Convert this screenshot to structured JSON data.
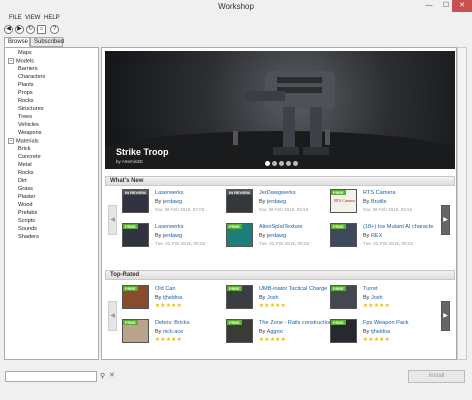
{
  "window": {
    "title": "Workshop"
  },
  "menu": [
    "FILE",
    "VIEW",
    "HELP"
  ],
  "tabs": [
    "Browse",
    "Subscribed"
  ],
  "tree": [
    {
      "label": "Maps",
      "level": 1,
      "expander": ""
    },
    {
      "label": "Models",
      "level": 0,
      "expander": "−"
    },
    {
      "label": "Barriers",
      "level": 1,
      "expander": ""
    },
    {
      "label": "Characters",
      "level": 1,
      "expander": ""
    },
    {
      "label": "Plants",
      "level": 1,
      "expander": ""
    },
    {
      "label": "Props",
      "level": 1,
      "expander": ""
    },
    {
      "label": "Rocks",
      "level": 1,
      "expander": ""
    },
    {
      "label": "Structures",
      "level": 1,
      "expander": ""
    },
    {
      "label": "Trees",
      "level": 1,
      "expander": ""
    },
    {
      "label": "Vehicles",
      "level": 1,
      "expander": ""
    },
    {
      "label": "Weapons",
      "level": 1,
      "expander": ""
    },
    {
      "label": "Materials",
      "level": 0,
      "expander": "−"
    },
    {
      "label": "Brick",
      "level": 1,
      "expander": ""
    },
    {
      "label": "Concrete",
      "level": 1,
      "expander": ""
    },
    {
      "label": "Metal",
      "level": 1,
      "expander": ""
    },
    {
      "label": "Rocks",
      "level": 1,
      "expander": ""
    },
    {
      "label": "Dirt",
      "level": 1,
      "expander": ""
    },
    {
      "label": "Grass",
      "level": 1,
      "expander": ""
    },
    {
      "label": "Plaster",
      "level": 1,
      "expander": ""
    },
    {
      "label": "Wood",
      "level": 1,
      "expander": ""
    },
    {
      "label": "Prefabs",
      "level": 0,
      "expander": ""
    },
    {
      "label": "Scripts",
      "level": 0,
      "expander": ""
    },
    {
      "label": "Sounds",
      "level": 0,
      "expander": ""
    },
    {
      "label": "Shaders",
      "level": 0,
      "expander": ""
    }
  ],
  "featured": {
    "title": "Strike Troop",
    "author": "by Artemis3D",
    "slide_count": 5,
    "active_slide": 0
  },
  "sections": [
    {
      "title": "What's New",
      "items": [
        {
          "name": "Laserwerks",
          "by_label": "By",
          "author": "jerdawg",
          "date": "Sat, 06 Feb 2016, 07:03",
          "badge": "IN REVIEW",
          "badge_color": "#555555",
          "thumb_bg": "#2f3440"
        },
        {
          "name": "JerDawgwerks",
          "by_label": "By",
          "author": "jerdawg",
          "date": "Sat, 06 Feb 2016, 06:53",
          "badge": "IN REVIEW",
          "badge_color": "#555555",
          "thumb_bg": "#34383e"
        },
        {
          "name": "RTS Camera",
          "by_label": "By",
          "author": "Brutile",
          "date": "Sat, 06 Feb 2016, 06:52",
          "badge": "FREE",
          "badge_color": "#5cae2e",
          "thumb_bg": "#f4f1ea",
          "thumb_text": "RTS Camera"
        },
        {
          "name": "Laserwerks",
          "by_label": "By",
          "author": "jerdawg",
          "date": "Tue, 02 Feb 2016, 06:03",
          "badge": "FREE",
          "badge_color": "#5cae2e",
          "thumb_bg": "#2f3440"
        },
        {
          "name": "AlienSplatTexture",
          "by_label": "By",
          "author": "jerdawg",
          "date": "Tue, 02 Feb 2016, 06:03",
          "badge": "FREE",
          "badge_color": "#5cae2e",
          "thumb_bg": "#1e7f7a"
        },
        {
          "name": "(18+) Ice Mutant AI characte",
          "by_label": "By",
          "author": "REX",
          "date": "Tue, 02 Feb 2016, 06:02",
          "badge": "FREE",
          "badge_color": "#5cae2e",
          "thumb_bg": "#3d4a5c"
        }
      ]
    },
    {
      "title": "Top-Rated",
      "items": [
        {
          "name": "Old Can",
          "by_label": "By",
          "author": "tjheldna",
          "rating": "★★★★★",
          "badge": "FREE",
          "badge_color": "#5cae2e",
          "thumb_bg": "#8a4a2c"
        },
        {
          "name": "UMB-inator Tactical Charge",
          "by_label": "By",
          "author": "Josh",
          "rating": "★★★★★",
          "badge": "FREE",
          "badge_color": "#5cae2e",
          "thumb_bg": "#3a3e44"
        },
        {
          "name": "Turret",
          "by_label": "By",
          "author": "Josh",
          "rating": "★★★★★",
          "badge": "FREE",
          "badge_color": "#5cae2e",
          "thumb_bg": "#44484e"
        },
        {
          "name": "Debris: Bricks",
          "by_label": "By",
          "author": "nick.ace",
          "rating": "★★★★★",
          "badge": "FREE",
          "badge_color": "#5cae2e",
          "thumb_bg": "#b9a38a"
        },
        {
          "name": "The Zone - Rails construction",
          "by_label": "By",
          "author": "Aggror",
          "rating": "★★★★★",
          "badge": "FREE",
          "badge_color": "#5cae2e",
          "thumb_bg": "#3a3a36"
        },
        {
          "name": "Fps Weapon Pack",
          "by_label": "By",
          "author": "tjheldna",
          "rating": "★★★★★",
          "badge": "FREE",
          "badge_color": "#5cae2e",
          "thumb_bg": "#26292d"
        }
      ]
    }
  ],
  "bottom": {
    "search_value": "",
    "install_label": "Install"
  },
  "icons": {
    "back": "back-icon",
    "forward": "forward-icon",
    "refresh": "refresh-icon",
    "home": "home-icon",
    "help": "help-icon",
    "search": "search-icon",
    "clear": "clear-icon"
  }
}
